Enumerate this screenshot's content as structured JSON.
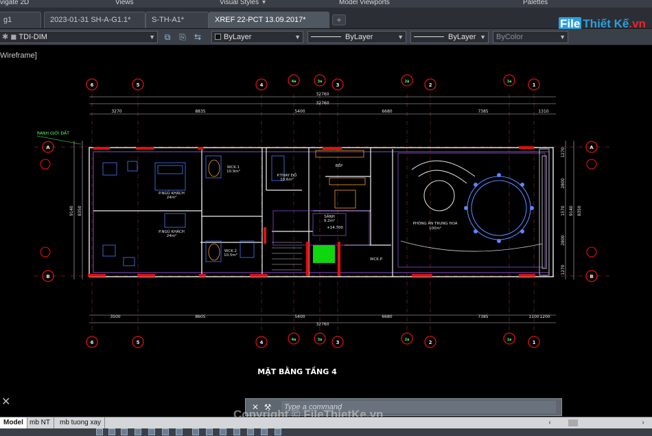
{
  "ribbon_panels": [
    "vigate 2D",
    "Views",
    "Visual Styles",
    "Model Viewports",
    "Palettes"
  ],
  "doc_tabs": [
    {
      "label": "g1",
      "active": false
    },
    {
      "label": "2023-01-31 SH-A-G1.1*",
      "active": false
    },
    {
      "label": "S-TH-A1*",
      "active": false
    },
    {
      "label": "XREF 22-PCT 13.09.2017*",
      "active": true
    }
  ],
  "logo": {
    "part1": "File",
    "part2": "Thiết Kế",
    "part3": ".vn"
  },
  "properties": {
    "layer": "TDI-DIM",
    "color": "ByLayer",
    "linetype": "ByLayer",
    "lineweight": "ByLayer",
    "plotstyle": "ByColor"
  },
  "viewport_label": "Wireframe]",
  "drawing": {
    "title": "MẶT BẰNG TẦNG 4",
    "grid_top": [
      "6",
      "5",
      "4",
      "4a",
      "3a",
      "3",
      "2a",
      "2",
      "1a",
      "1"
    ],
    "grid_side": [
      "A",
      "B"
    ],
    "overall_dim": "32760",
    "top_dims": [
      "3270",
      "8835",
      "5400",
      "6680",
      "7385",
      "1310"
    ],
    "bottom_dims": [
      "3500",
      "8605",
      "5400",
      "6680",
      "7385",
      "1100",
      "1200"
    ],
    "side_dims": [
      "1270",
      "2800",
      "1570",
      "2800",
      "1270"
    ],
    "side_total": "9140",
    "side_total_right": "8350",
    "boundary_note": "RANH GIỚI ĐẤT",
    "rooms": [
      {
        "name": "P.NGỦ KHÁCH",
        "area": "24m²"
      },
      {
        "name": "P.NGỦ KHÁCH",
        "area": "24m²"
      },
      {
        "name": "WCK.1",
        "area": "10.9m²"
      },
      {
        "name": "WCK.2",
        "area": "10.5m²"
      },
      {
        "name": "P.THAY ĐỒ",
        "area": "10.6m²"
      },
      {
        "name": "BẾP",
        "area": ""
      },
      {
        "name": "SẢNH",
        "area": "9.2m²"
      },
      {
        "name": "PHÒNG ĂN TRUNG HOA",
        "area": "100m²"
      },
      {
        "name": "WCK.P",
        "area": ""
      }
    ],
    "level_tag": "+14.700"
  },
  "command": {
    "placeholder": "Type a command"
  },
  "watermark": "Copyright © FileThietKe.vn",
  "layout_tabs": [
    "Model",
    "mb NT",
    "mb tuong xay"
  ]
}
